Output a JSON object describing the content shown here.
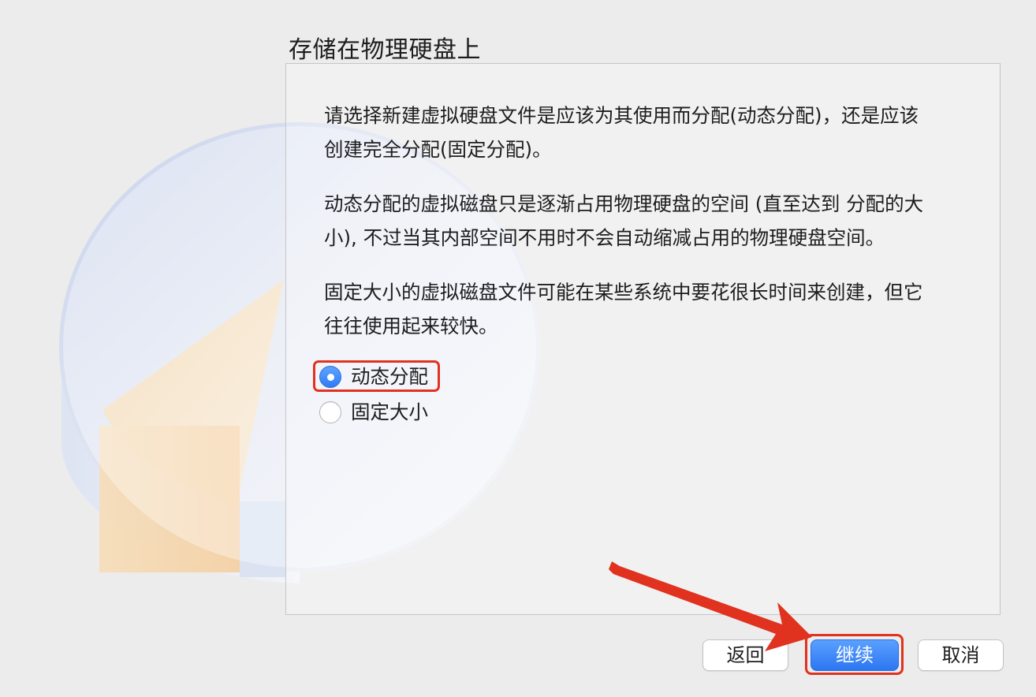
{
  "page": {
    "title": "存储在物理硬盘上"
  },
  "content": {
    "paragraph_1": "请选择新建虚拟硬盘文件是应该为其使用而分配(动态分配)，还是应该\n创建完全分配(固定分配)。",
    "paragraph_2": "动态分配的虚拟磁盘只是逐渐占用物理硬盘的空间 (直至达到 分配的大\n小), 不过当其内部空间不用时不会自动缩减占用的物理硬盘空间。",
    "paragraph_3": "固定大小的虚拟磁盘文件可能在某些系统中要花很长时间来创建，但它\n往往使用起来较快。"
  },
  "options": {
    "dynamic": {
      "label": "动态分配",
      "selected": true
    },
    "fixed": {
      "label": "固定大小",
      "selected": false
    }
  },
  "buttons": {
    "back": "返回",
    "continue": "继续",
    "cancel": "取消"
  },
  "colors": {
    "accent": "#2f7cf6",
    "annotation": "#e0321e",
    "background": "#ececec"
  }
}
